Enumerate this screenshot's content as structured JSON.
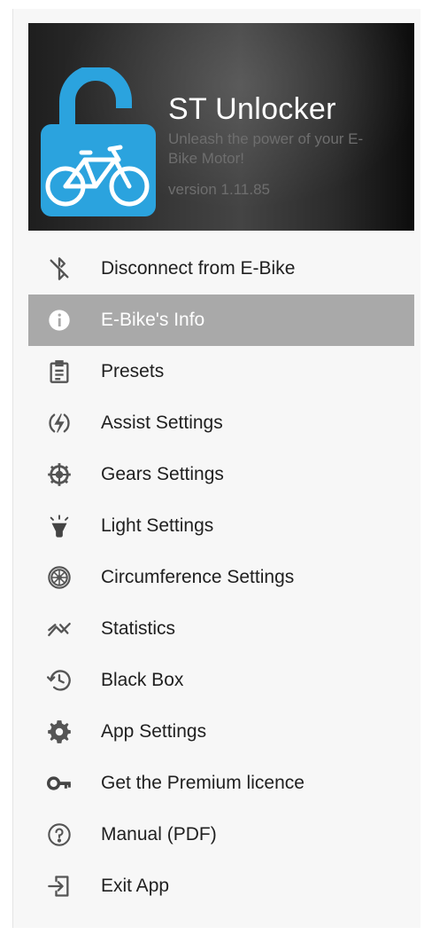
{
  "header": {
    "title": "ST Unlocker",
    "tagline": "Unleash the power of your E-Bike Motor!",
    "version": "version 1.11.85",
    "logo_icon": "padlock-bicycle-icon",
    "logo_color": "#2ba3de"
  },
  "menu": {
    "active_index": 1,
    "active_color": "#a9a9a9",
    "items": [
      {
        "label": "Disconnect from E-Bike",
        "icon": "bluetooth-disabled-icon"
      },
      {
        "label": "E-Bike's Info",
        "icon": "info-icon"
      },
      {
        "label": "Presets",
        "icon": "clipboard-list-icon"
      },
      {
        "label": "Assist Settings",
        "icon": "lightning-circle-icon"
      },
      {
        "label": "Gears Settings",
        "icon": "gear-wheel-icon"
      },
      {
        "label": "Light Settings",
        "icon": "lamp-icon"
      },
      {
        "label": "Circumference Settings",
        "icon": "wheel-icon"
      },
      {
        "label": "Statistics",
        "icon": "trend-chart-icon"
      },
      {
        "label": "Black Box",
        "icon": "history-icon"
      },
      {
        "label": "App Settings",
        "icon": "settings-cog-icon"
      },
      {
        "label": "Get the Premium licence",
        "icon": "key-icon"
      },
      {
        "label": "Manual (PDF)",
        "icon": "help-circle-icon"
      },
      {
        "label": "Exit App",
        "icon": "exit-icon"
      }
    ]
  }
}
